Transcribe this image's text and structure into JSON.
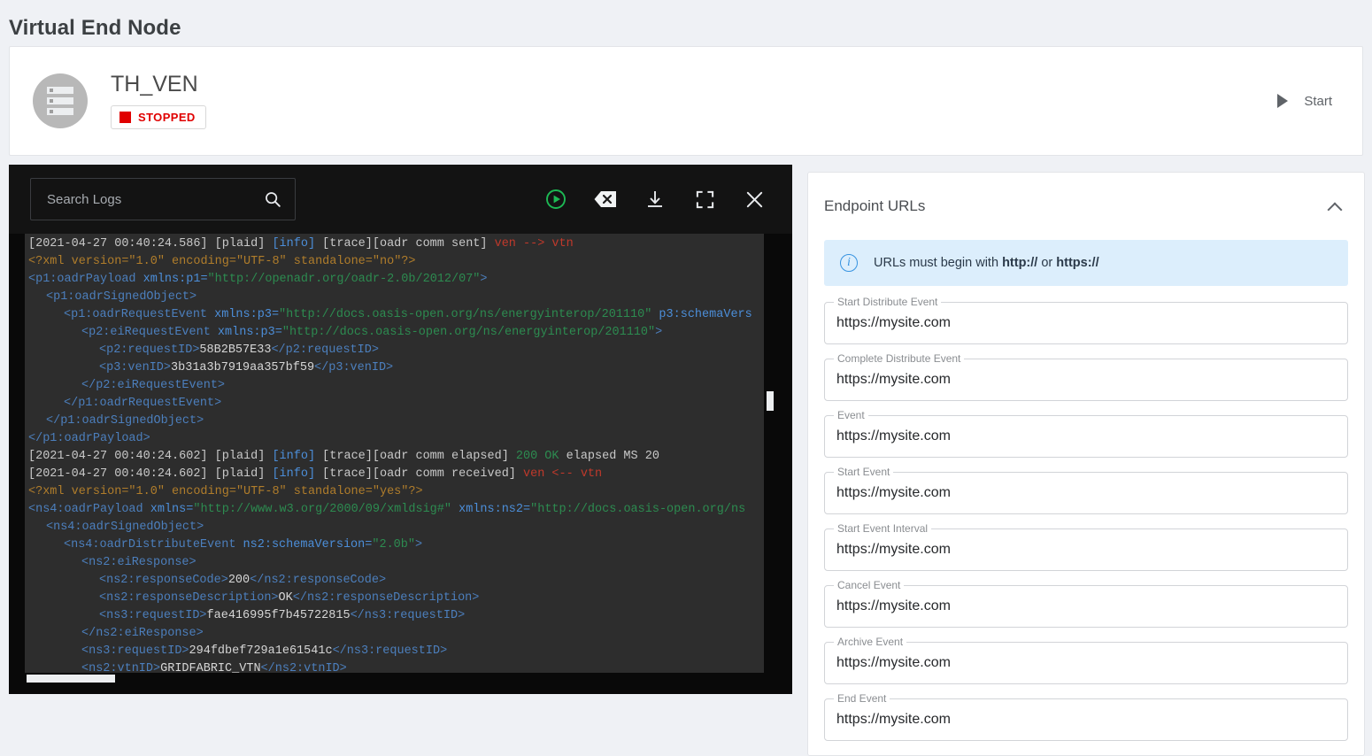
{
  "page": {
    "title": "Virtual End Node"
  },
  "ven": {
    "name": "TH_VEN",
    "status": "STOPPED",
    "status_color": "#e00000",
    "avatar_icon": "server-storage-icon",
    "start_label": "Start"
  },
  "console": {
    "search_placeholder": "Search Logs",
    "search_value": "",
    "icons": {
      "search": "search-icon",
      "run": "play-circle-icon",
      "clear": "backspace-clear-icon",
      "download": "download-icon",
      "fullscreen": "fullscreen-icon",
      "close": "close-icon"
    },
    "log_lines": [
      {
        "id": 1,
        "indent": 0,
        "tokens": [
          {
            "t": "[2021-04-27 00:40:24.586] [plaid] ",
            "c": "t-plain"
          },
          {
            "t": "[info]",
            "c": "t-info"
          },
          {
            "t": " [trace][oadr comm sent] ",
            "c": "t-plain"
          },
          {
            "t": "ven --> vtn",
            "c": "t-red"
          }
        ]
      },
      {
        "id": 2,
        "indent": 0,
        "tokens": [
          {
            "t": "<?xml version=",
            "c": "t-orange"
          },
          {
            "t": "\"1.0\"",
            "c": "t-orange"
          },
          {
            "t": " encoding=",
            "c": "t-orange"
          },
          {
            "t": "\"UTF-8\"",
            "c": "t-orange"
          },
          {
            "t": " standalone=",
            "c": "t-orange"
          },
          {
            "t": "\"no\"?>",
            "c": "t-orange"
          }
        ]
      },
      {
        "id": 3,
        "indent": 0,
        "tokens": [
          {
            "t": "<p1:oadrPayload",
            "c": "t-tag"
          },
          {
            "t": " xmlns:p1=",
            "c": "t-attr"
          },
          {
            "t": "\"http://openadr.org/oadr-2.0b/2012/07\"",
            "c": "t-str"
          },
          {
            "t": ">",
            "c": "t-tag"
          }
        ]
      },
      {
        "id": 4,
        "indent": 1,
        "tokens": [
          {
            "t": "<p1:oadrSignedObject>",
            "c": "t-tag"
          }
        ]
      },
      {
        "id": 5,
        "indent": 2,
        "tokens": [
          {
            "t": "<p1:oadrRequestEvent",
            "c": "t-tag"
          },
          {
            "t": " xmlns:p3=",
            "c": "t-attr"
          },
          {
            "t": "\"http://docs.oasis-open.org/ns/energyinterop/201110\"",
            "c": "t-str"
          },
          {
            "t": " p3:schemaVers",
            "c": "t-attr"
          }
        ]
      },
      {
        "id": 6,
        "indent": 3,
        "tokens": [
          {
            "t": "<p2:eiRequestEvent",
            "c": "t-tag"
          },
          {
            "t": " xmlns:p3=",
            "c": "t-attr"
          },
          {
            "t": "\"http://docs.oasis-open.org/ns/energyinterop/201110\"",
            "c": "t-str"
          },
          {
            "t": ">",
            "c": "t-tag"
          }
        ]
      },
      {
        "id": 7,
        "indent": 4,
        "tokens": [
          {
            "t": "<p2:requestID>",
            "c": "t-tag"
          },
          {
            "t": "58B2B57E33",
            "c": "t-val"
          },
          {
            "t": "</p2:requestID>",
            "c": "t-tag"
          }
        ]
      },
      {
        "id": 8,
        "indent": 4,
        "tokens": [
          {
            "t": "<p3:venID>",
            "c": "t-tag"
          },
          {
            "t": "3b31a3b7919aa357bf59",
            "c": "t-val"
          },
          {
            "t": "</p3:venID>",
            "c": "t-tag"
          }
        ]
      },
      {
        "id": 9,
        "indent": 3,
        "tokens": [
          {
            "t": "</p2:eiRequestEvent>",
            "c": "t-tag"
          }
        ]
      },
      {
        "id": 10,
        "indent": 2,
        "tokens": [
          {
            "t": "</p1:oadrRequestEvent>",
            "c": "t-tag"
          }
        ]
      },
      {
        "id": 11,
        "indent": 1,
        "tokens": [
          {
            "t": "</p1:oadrSignedObject>",
            "c": "t-tag"
          }
        ]
      },
      {
        "id": 12,
        "indent": 0,
        "tokens": [
          {
            "t": "</p1:oadrPayload>",
            "c": "t-tag"
          }
        ]
      },
      {
        "id": 13,
        "indent": 0,
        "tokens": [
          {
            "t": "[2021-04-27 00:40:24.602] [plaid] ",
            "c": "t-plain"
          },
          {
            "t": "[info]",
            "c": "t-info"
          },
          {
            "t": " [trace][oadr comm elapsed] ",
            "c": "t-plain"
          },
          {
            "t": "200 OK",
            "c": "t-green"
          },
          {
            "t": " elapsed MS 20",
            "c": "t-plain"
          }
        ]
      },
      {
        "id": 14,
        "indent": 0,
        "tokens": [
          {
            "t": "[2021-04-27 00:40:24.602] [plaid] ",
            "c": "t-plain"
          },
          {
            "t": "[info]",
            "c": "t-info"
          },
          {
            "t": " [trace][oadr comm received] ",
            "c": "t-plain"
          },
          {
            "t": "ven <-- vtn",
            "c": "t-red"
          }
        ]
      },
      {
        "id": 15,
        "indent": 0,
        "tokens": [
          {
            "t": "<?xml version=\"1.0\" encoding=\"UTF-8\" standalone=\"yes\"?>",
            "c": "t-orange"
          }
        ]
      },
      {
        "id": 16,
        "indent": 0,
        "tokens": [
          {
            "t": "<ns4:oadrPayload",
            "c": "t-tag"
          },
          {
            "t": " xmlns=",
            "c": "t-attr"
          },
          {
            "t": "\"http://www.w3.org/2000/09/xmldsig#\"",
            "c": "t-str"
          },
          {
            "t": " xmlns:ns2=",
            "c": "t-attr"
          },
          {
            "t": "\"http://docs.oasis-open.org/ns",
            "c": "t-str"
          }
        ]
      },
      {
        "id": 17,
        "indent": 1,
        "tokens": [
          {
            "t": "<ns4:oadrSignedObject>",
            "c": "t-tag"
          }
        ]
      },
      {
        "id": 18,
        "indent": 2,
        "tokens": [
          {
            "t": "<ns4:oadrDistributeEvent",
            "c": "t-tag"
          },
          {
            "t": " ns2:schemaVersion=",
            "c": "t-attr"
          },
          {
            "t": "\"2.0b\"",
            "c": "t-str"
          },
          {
            "t": ">",
            "c": "t-tag"
          }
        ]
      },
      {
        "id": 19,
        "indent": 3,
        "tokens": [
          {
            "t": "<ns2:eiResponse>",
            "c": "t-tag"
          }
        ]
      },
      {
        "id": 20,
        "indent": 4,
        "tokens": [
          {
            "t": "<ns2:responseCode>",
            "c": "t-tag"
          },
          {
            "t": "200",
            "c": "t-val"
          },
          {
            "t": "</ns2:responseCode>",
            "c": "t-tag"
          }
        ]
      },
      {
        "id": 21,
        "indent": 4,
        "tokens": [
          {
            "t": "<ns2:responseDescription>",
            "c": "t-tag"
          },
          {
            "t": "OK",
            "c": "t-val"
          },
          {
            "t": "</ns2:responseDescription>",
            "c": "t-tag"
          }
        ]
      },
      {
        "id": 22,
        "indent": 4,
        "tokens": [
          {
            "t": "<ns3:requestID>",
            "c": "t-tag"
          },
          {
            "t": "fae416995f7b45722815",
            "c": "t-val"
          },
          {
            "t": "</ns3:requestID>",
            "c": "t-tag"
          }
        ]
      },
      {
        "id": 23,
        "indent": 3,
        "tokens": [
          {
            "t": "</ns2:eiResponse>",
            "c": "t-tag"
          }
        ]
      },
      {
        "id": 24,
        "indent": 3,
        "tokens": [
          {
            "t": "<ns3:requestID>",
            "c": "t-tag"
          },
          {
            "t": "294fdbef729a1e61541c",
            "c": "t-val"
          },
          {
            "t": "</ns3:requestID>",
            "c": "t-tag"
          }
        ]
      },
      {
        "id": 25,
        "indent": 3,
        "tokens": [
          {
            "t": "<ns2:vtnID>",
            "c": "t-tag"
          },
          {
            "t": "GRIDFABRIC_VTN",
            "c": "t-val"
          },
          {
            "t": "</ns2:vtnID>",
            "c": "t-tag"
          }
        ]
      }
    ]
  },
  "endpoint_panel": {
    "title": "Endpoint URLs",
    "collapse_icon": "chevron-up-icon",
    "banner": {
      "icon": "info-circle-icon",
      "prefix": "URLs must begin with ",
      "scheme1": "http://",
      "middle": " or ",
      "scheme2": "https://"
    },
    "fields": [
      {
        "label": "Start Distribute Event",
        "value": "https://mysite.com"
      },
      {
        "label": "Complete Distribute Event",
        "value": "https://mysite.com"
      },
      {
        "label": "Event",
        "value": "https://mysite.com"
      },
      {
        "label": "Start Event",
        "value": "https://mysite.com"
      },
      {
        "label": "Start Event Interval",
        "value": "https://mysite.com"
      },
      {
        "label": "Cancel Event",
        "value": "https://mysite.com"
      },
      {
        "label": "Archive Event",
        "value": "https://mysite.com"
      },
      {
        "label": "End Event",
        "value": "https://mysite.com"
      }
    ]
  }
}
